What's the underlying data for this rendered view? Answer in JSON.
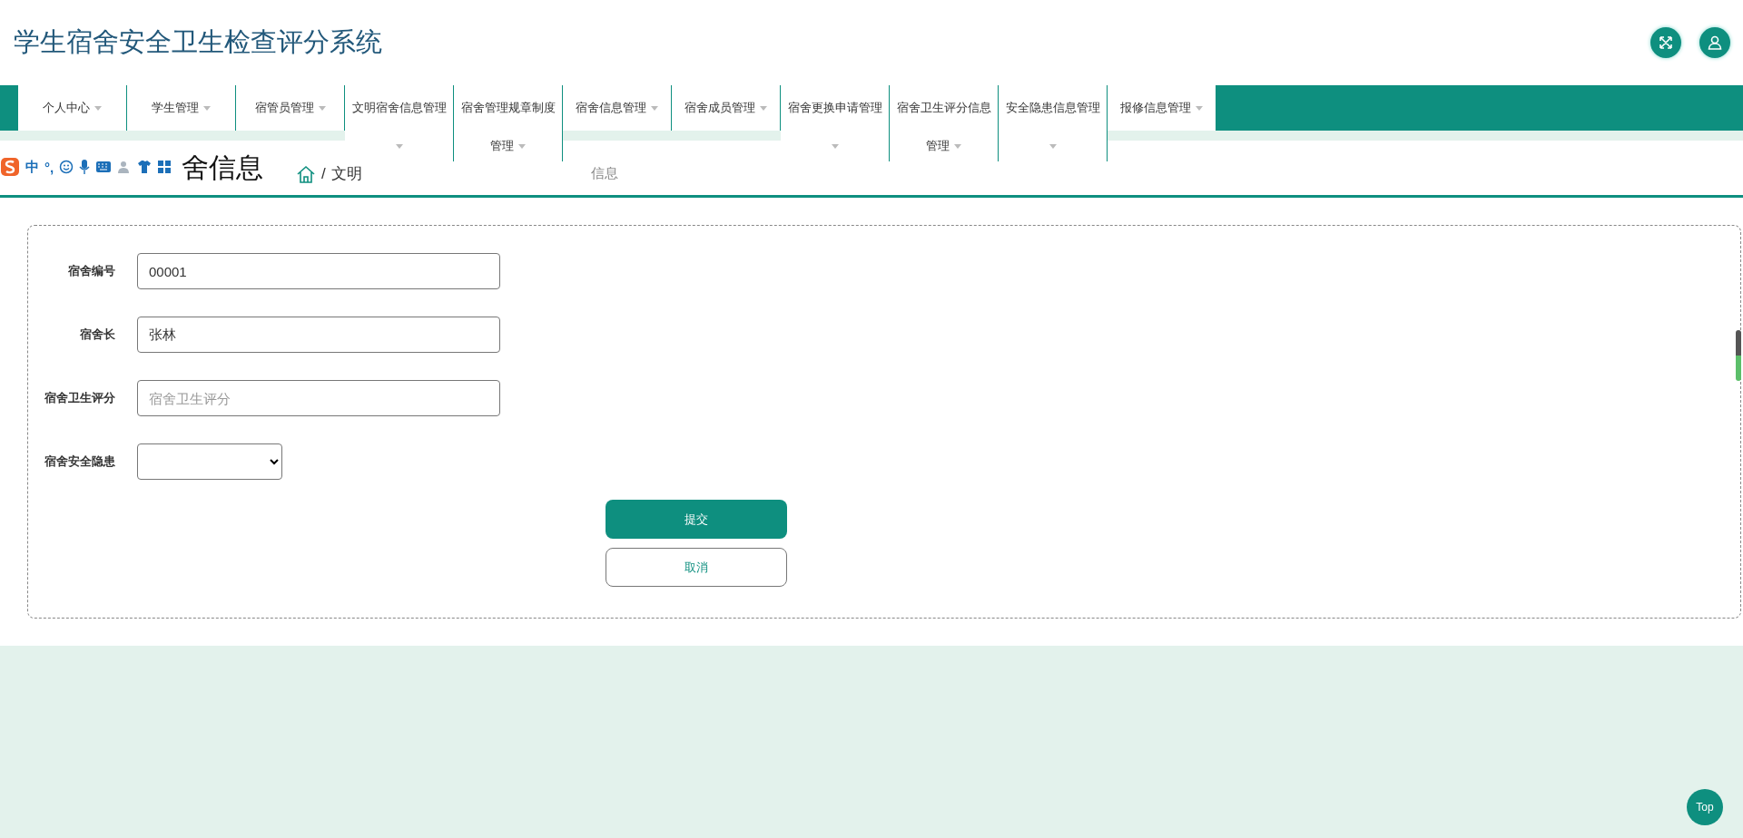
{
  "header": {
    "title": "学生宿舍安全卫生检查评分系统"
  },
  "nav": [
    {
      "label": "个人中心",
      "wrapped": false
    },
    {
      "label": "学生管理",
      "wrapped": false
    },
    {
      "label": "宿管员管理",
      "wrapped": false
    },
    {
      "label": "文明宿舍信息管理",
      "wrapped": true
    },
    {
      "label": "宿舍管理规章制度",
      "label2": "管理",
      "wrapped": true
    },
    {
      "label": "宿舍信息管理",
      "wrapped": false
    },
    {
      "label": "宿舍成员管理",
      "wrapped": false
    },
    {
      "label": "宿舍更换申请管理",
      "wrapped": true
    },
    {
      "label": "宿舍卫生评分信息",
      "label2": "管理",
      "wrapped": true
    },
    {
      "label": "安全隐患信息管理",
      "wrapped": true
    },
    {
      "label": "报修信息管理",
      "wrapped": false
    }
  ],
  "ime_toolbar": {
    "mode": "中",
    "punct": "°,"
  },
  "page_title": "舍信息",
  "breadcrumb": {
    "separator": "/",
    "first": "文明",
    "last": "信息"
  },
  "form": {
    "fields": [
      {
        "label": "宿舍编号",
        "kind": "text",
        "value": "00001"
      },
      {
        "label": "宿舍长",
        "kind": "text",
        "value": "张林"
      },
      {
        "label": "宿舍卫生评分",
        "kind": "text",
        "placeholder": "宿舍卫生评分"
      },
      {
        "label": "宿舍安全隐患",
        "kind": "select"
      }
    ],
    "submit": "提交",
    "cancel": "取消"
  },
  "top_button": "Top"
}
